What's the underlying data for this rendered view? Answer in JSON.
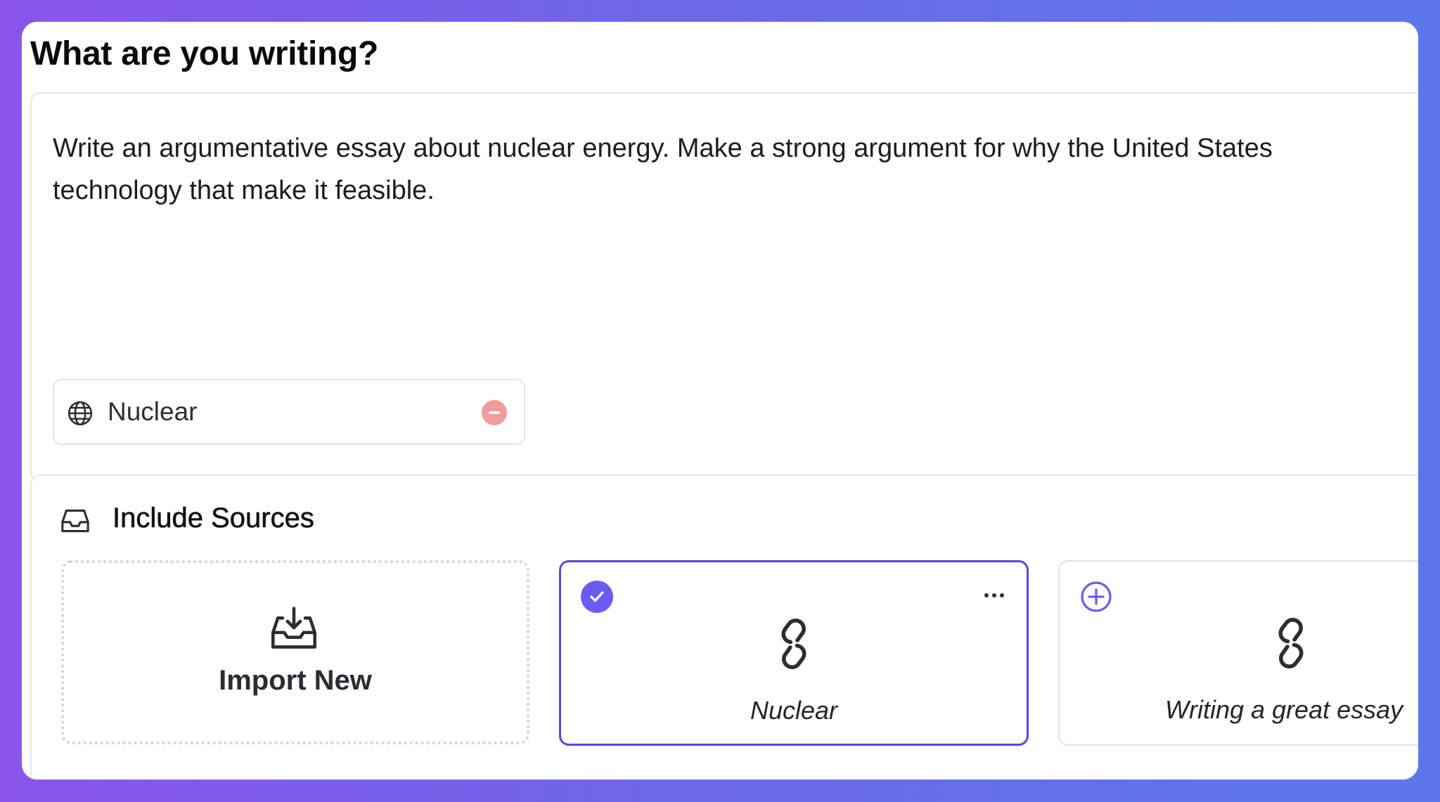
{
  "header": {
    "title": "What are you writing?"
  },
  "prompt": {
    "text": "Write an argumentative essay about nuclear energy. Make a strong argument for why the United States\ntechnology that make it feasible.",
    "chip": {
      "icon": "globe-icon",
      "label": "Nuclear",
      "remove_icon": "minus-circle-icon"
    }
  },
  "sources": {
    "icon": "inbox-icon",
    "title": "Include Sources",
    "import_tile": {
      "icon": "import-download-icon",
      "label": "Import New"
    },
    "items": [
      {
        "label": "Nuclear",
        "selected": true,
        "status_icon": "check-circle-icon",
        "menu_icon": "more-horizontal-icon",
        "type_icon": "link-icon"
      },
      {
        "label": "Writing a great essay",
        "selected": false,
        "status_icon": "plus-circle-icon",
        "type_icon": "link-icon"
      }
    ]
  },
  "colors": {
    "accent": "#5a46e3",
    "check_badge": "#6a5cf0",
    "remove": "#f29b9b",
    "background_gradient_start": "#8b55e9",
    "background_gradient_end": "#5a78ea"
  }
}
